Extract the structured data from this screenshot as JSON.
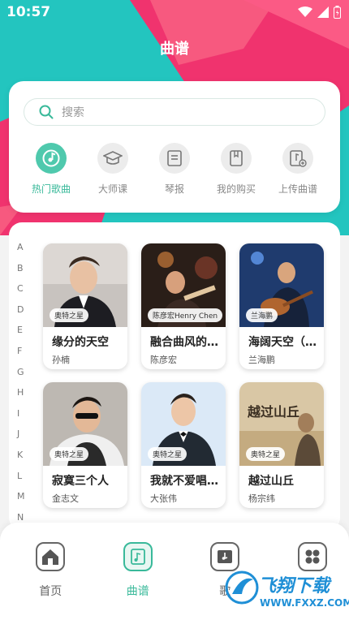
{
  "status": {
    "time": "10:57"
  },
  "header": {
    "title": "曲谱"
  },
  "search": {
    "placeholder": "搜索"
  },
  "categories": [
    {
      "label": "热门歌曲",
      "icon": "music-disc-icon",
      "active": true
    },
    {
      "label": "大师课",
      "icon": "graduation-cap-icon",
      "active": false
    },
    {
      "label": "琴报",
      "icon": "newspaper-icon",
      "active": false
    },
    {
      "label": "我的购买",
      "icon": "book-icon",
      "active": false
    },
    {
      "label": "上传曲谱",
      "icon": "upload-score-icon",
      "active": false
    }
  ],
  "alphabet": [
    "A",
    "B",
    "C",
    "D",
    "E",
    "F",
    "G",
    "H",
    "I",
    "J",
    "K",
    "L",
    "M",
    "N"
  ],
  "songs": [
    {
      "title": "缘分的天空",
      "artist": "孙楠",
      "tag": "奥特之星"
    },
    {
      "title": "融合曲风的...",
      "artist": "陈彦宏",
      "tag": "陈彦宏Henry Chen"
    },
    {
      "title": "海阔天空（...",
      "artist": "兰海鹏",
      "tag": "兰海鹏"
    },
    {
      "title": "寂寞三个人",
      "artist": "金志文",
      "tag": "奥特之星"
    },
    {
      "title": "我就不爱唱...",
      "artist": "大张伟",
      "tag": "奥特之星"
    },
    {
      "title": "越过山丘",
      "artist": "杨宗纬",
      "tag": "奥特之星",
      "art_text": "越过山丘"
    }
  ],
  "nav": [
    {
      "label": "首页",
      "icon": "home-icon"
    },
    {
      "label": "曲谱",
      "icon": "score-icon",
      "active": true
    },
    {
      "label": "歌",
      "icon": "piano-icon"
    },
    {
      "label": "",
      "icon": "grid-menu-icon"
    }
  ],
  "watermark": {
    "text": "飞翔下载",
    "url": "WWW.FXXZ.COM"
  },
  "colors": {
    "accent": "#39b99a",
    "pink": "#f0336e",
    "teal": "#2dc6c0"
  }
}
